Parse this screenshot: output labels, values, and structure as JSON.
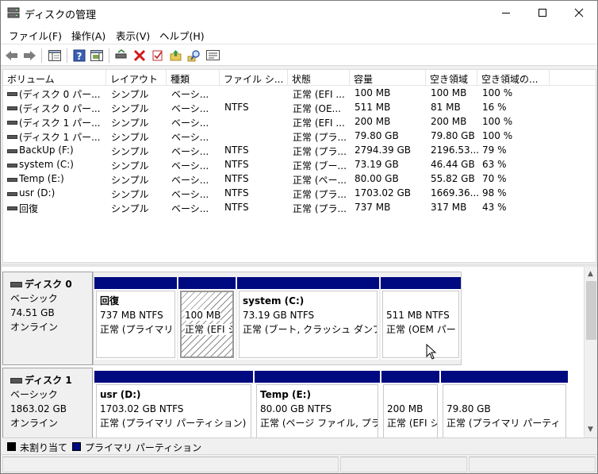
{
  "window": {
    "title": "ディスクの管理"
  },
  "menu": {
    "items": [
      "ファイル(F)",
      "操作(A)",
      "表示(V)",
      "ヘルプ(H)"
    ]
  },
  "list": {
    "columns": [
      "ボリューム",
      "レイアウト",
      "種類",
      "ファイル シ...",
      "状態",
      "容量",
      "空き領域",
      "空き領域の..."
    ],
    "rows": [
      [
        "(ディスク 0 パー...",
        "シンプル",
        "ベーシ...",
        "",
        "正常 (EFI ...",
        "100 MB",
        "100 MB",
        "100 %"
      ],
      [
        "(ディスク 0 パー...",
        "シンプル",
        "ベーシ...",
        "NTFS",
        "正常 (OE...",
        "511 MB",
        "81 MB",
        "16 %"
      ],
      [
        "(ディスク 1 パー...",
        "シンプル",
        "ベーシ...",
        "",
        "正常 (EFI ...",
        "200 MB",
        "200 MB",
        "100 %"
      ],
      [
        "(ディスク 1 パー...",
        "シンプル",
        "ベーシ...",
        "",
        "正常 (プラ...",
        "79.80 GB",
        "79.80 GB",
        "100 %"
      ],
      [
        "BackUp (F:)",
        "シンプル",
        "ベーシ...",
        "NTFS",
        "正常 (プラ...",
        "2794.39 GB",
        "2196.53...",
        "79 %"
      ],
      [
        "system (C:)",
        "シンプル",
        "ベーシ...",
        "NTFS",
        "正常 (ブー...",
        "73.19 GB",
        "46.44 GB",
        "63 %"
      ],
      [
        "Temp (E:)",
        "シンプル",
        "ベーシ...",
        "NTFS",
        "正常 (ペー...",
        "80.00 GB",
        "55.82 GB",
        "70 %"
      ],
      [
        "usr (D:)",
        "シンプル",
        "ベーシ...",
        "NTFS",
        "正常 (プラ...",
        "1703.02 GB",
        "1669.36...",
        "98 %"
      ],
      [
        "回復",
        "シンプル",
        "ベーシ...",
        "NTFS",
        "正常 (プラ...",
        "737 MB",
        "317 MB",
        "43 %"
      ]
    ]
  },
  "disks": [
    {
      "name": "ディスク 0",
      "type": "ベーシック",
      "size": "74.51 GB",
      "status": "オンライン",
      "partitions": [
        {
          "name": "回復",
          "size": "737 MB NTFS",
          "status": "正常 (プライマリ"
        },
        {
          "name": "",
          "size": "100 MB",
          "status": "正常 (EFI シ"
        },
        {
          "name": "system  (C:)",
          "size": "73.19 GB NTFS",
          "status": "正常 (ブート, クラッシュ ダンプ"
        },
        {
          "name": "",
          "size": "511 MB NTFS",
          "status": "正常 (OEM パー"
        }
      ]
    },
    {
      "name": "ディスク 1",
      "type": "ベーシック",
      "size": "1863.02 GB",
      "status": "オンライン",
      "partitions": [
        {
          "name": "usr  (D:)",
          "size": "1703.02 GB NTFS",
          "status": "正常 (プライマリ パーティション)"
        },
        {
          "name": "Temp  (E:)",
          "size": "80.00 GB NTFS",
          "status": "正常 (ページ ファイル, プラ"
        },
        {
          "name": "",
          "size": "200 MB",
          "status": "正常 (EFI シ"
        },
        {
          "name": "",
          "size": "79.80 GB",
          "status": "正常 (プライマリ パーティ"
        }
      ]
    }
  ],
  "legend": {
    "unallocated": "未割り当て",
    "primary": "プライマリ パーティション"
  },
  "colors": {
    "primary_bar": "#000a80",
    "unallocated": "#000000"
  }
}
